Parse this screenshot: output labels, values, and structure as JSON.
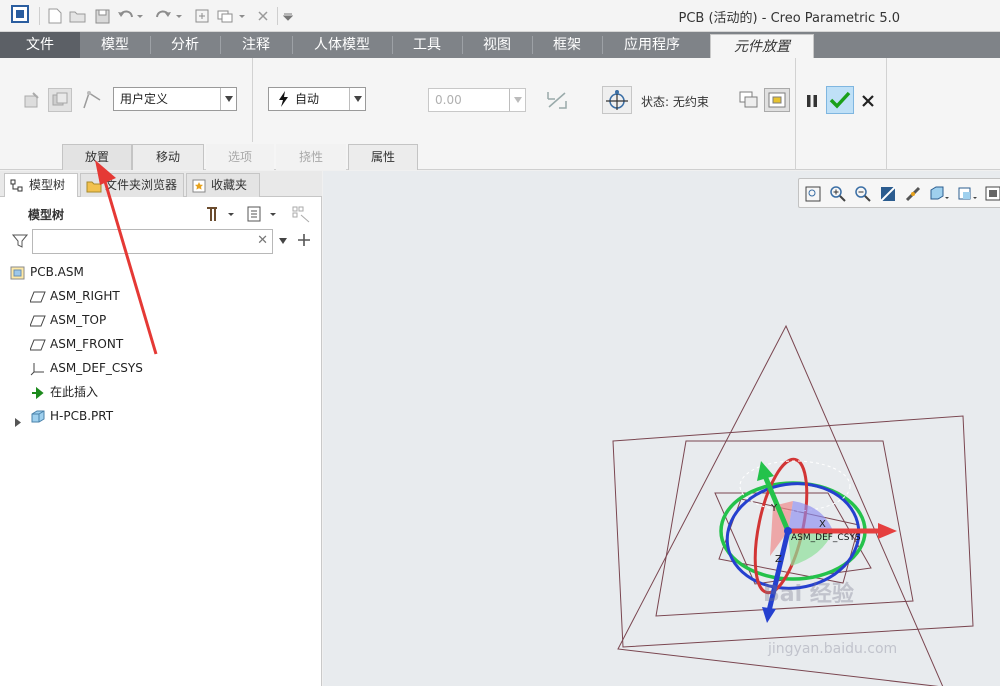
{
  "window": {
    "title": "PCB (活动的) - Creo Parametric 5.0"
  },
  "ribbon_tabs": [
    "文件",
    "模型",
    "分析",
    "注释",
    "人体模型",
    "工具",
    "视图",
    "框架",
    "应用程序",
    "元件放置"
  ],
  "active_tab": "元件放置",
  "placement": {
    "constraint_set": "用户定义",
    "constraint_type": "自动",
    "offset_value": "0.00",
    "status_label": "状态: 无约束"
  },
  "sub_tabs": [
    {
      "label": "放置",
      "enabled": true
    },
    {
      "label": "移动",
      "enabled": true
    },
    {
      "label": "选项",
      "enabled": false
    },
    {
      "label": "挠性",
      "enabled": false
    },
    {
      "label": "属性",
      "enabled": true
    }
  ],
  "panel_tabs": [
    "模型树",
    "文件夹浏览器",
    "收藏夹"
  ],
  "model_tree": {
    "header": "模型树",
    "filter_value": "",
    "nodes": [
      {
        "label": "PCB.ASM",
        "icon": "assembly-icon"
      },
      {
        "label": "ASM_RIGHT",
        "icon": "datum-plane-icon"
      },
      {
        "label": "ASM_TOP",
        "icon": "datum-plane-icon"
      },
      {
        "label": "ASM_FRONT",
        "icon": "datum-plane-icon"
      },
      {
        "label": "ASM_DEF_CSYS",
        "icon": "csys-icon"
      },
      {
        "label": "在此插入",
        "icon": "insert-here-icon"
      },
      {
        "label": "H-PCB.PRT",
        "icon": "part-icon"
      }
    ]
  },
  "viewport": {
    "csys_label": "ASM_DEF_CSYS",
    "axis_labels": [
      "Y",
      "X",
      "Z"
    ]
  },
  "watermark": {
    "brand": "Bai 经验",
    "url": "jingyan.baidu.com"
  },
  "colors": {
    "tab_bar": "#7f8388",
    "accent_check": "#1aa01a",
    "arrow_annotation": "#e53935"
  }
}
